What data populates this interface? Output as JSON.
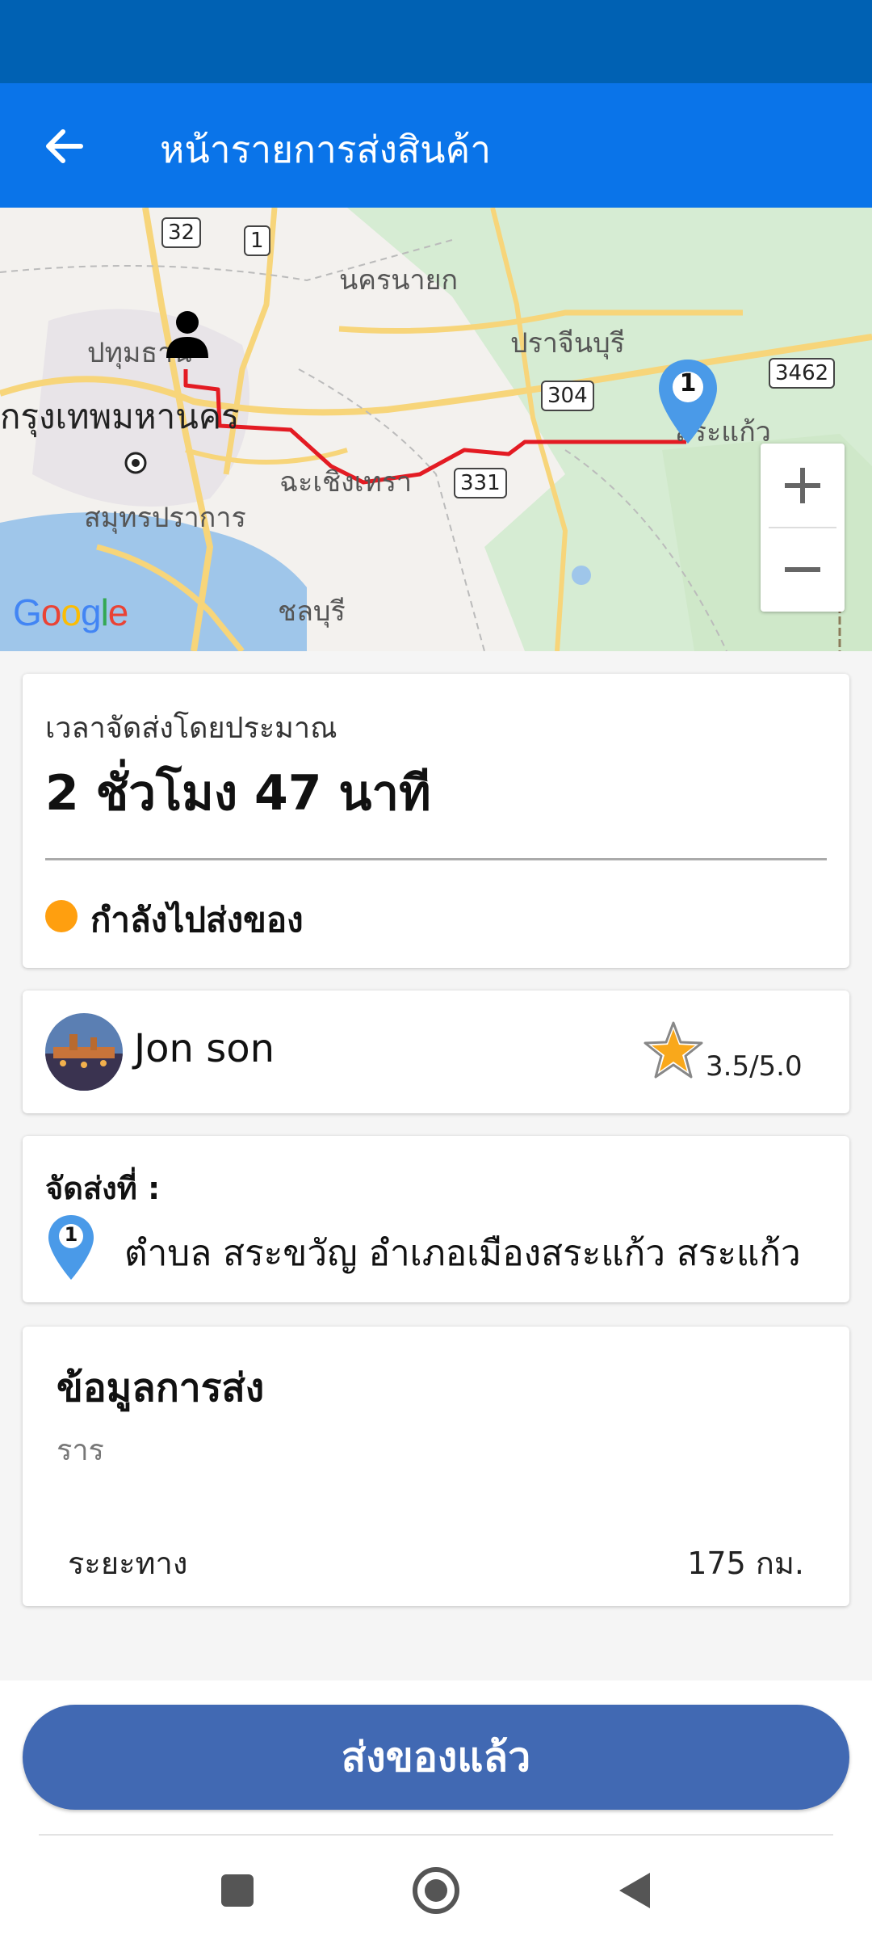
{
  "app_bar": {
    "title": "หน้ารายการส่งสินค้า",
    "back_icon": "arrow-left-icon"
  },
  "map": {
    "labels": {
      "nakhon_nayok": "นครนายก",
      "pathum": "ปทุมธานี",
      "prachin": "ปราจีนบุรี",
      "bangkok": "กรุงเทพมหานคร",
      "chachoengsao": "ฉะเชิงเทรา",
      "samut": "สมุทรปราการ",
      "chonburi": "ชลบุรี",
      "sa_kaeo": "สระแก้ว"
    },
    "shields": {
      "r32": "32",
      "r1": "1",
      "r304": "304",
      "r3462": "3462",
      "r331": "331"
    },
    "marker_number": "1",
    "zoom_in": "+",
    "zoom_out": "−",
    "route_color": "#e31b23"
  },
  "eta": {
    "label": "เวลาจัดส่งโดยประมาณ",
    "value": "2 ชั่วโมง 47 นาที",
    "status": "กำลังไปส่งของ",
    "status_color": "#ff9f0f"
  },
  "driver": {
    "name": "Jon son",
    "rating": "3.5/5.0"
  },
  "destination": {
    "label": "จัดส่งที่ :",
    "pin_number": "1",
    "address": "ตำบล สระขวัญ อำเภอเมืองสระแก้ว สระแก้ว"
  },
  "shipping_info": {
    "title": "ข้อมูลการส่ง",
    "subtitle": "ราร",
    "distance_label": "ระยะทาง",
    "distance_value": "175 กม."
  },
  "action": {
    "button_label": "ส่งของแล้ว"
  },
  "colors": {
    "status_bar": "#0061b3",
    "app_bar": "#0a74e9",
    "primary_button": "#4169b3"
  }
}
